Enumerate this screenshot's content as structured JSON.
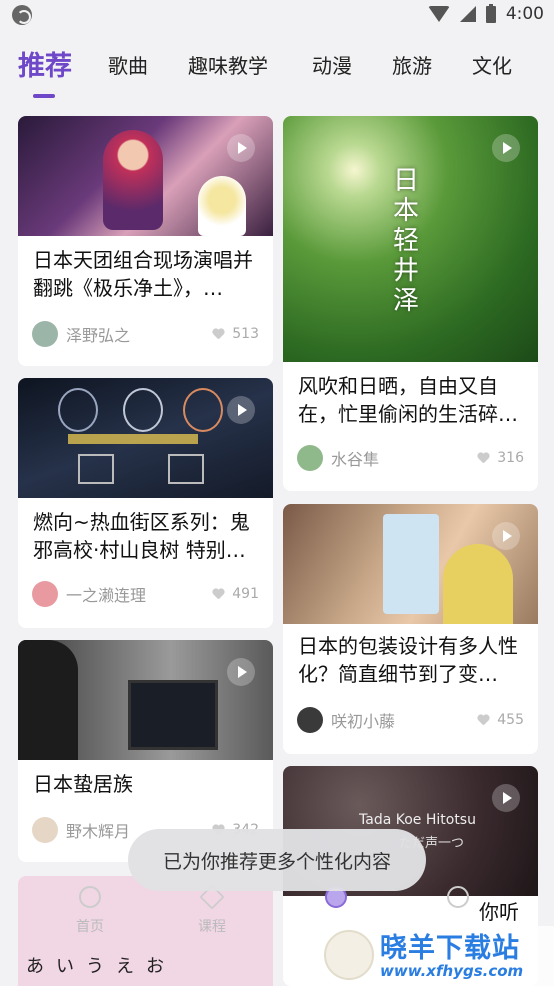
{
  "status_bar": {
    "time": "4:00"
  },
  "tabs": [
    {
      "label": "推荐",
      "active": true
    },
    {
      "label": "歌曲"
    },
    {
      "label": "趣味教学"
    },
    {
      "label": "动漫"
    },
    {
      "label": "旅游"
    },
    {
      "label": "文化"
    }
  ],
  "cards": [
    {
      "title": "日本天团组合现场演唱并翻跳《极乐净土》，…",
      "author": "泽野弘之",
      "likes": "513",
      "thumb_color": "#4a2a5e",
      "avatar_color": "#9bb5a8"
    },
    {
      "title": "风吹和日晒，自由又自在，忙里偷闲的生活碎…",
      "author": "水谷隼",
      "likes": "316",
      "thumb_color": "#3d7a2e",
      "avatar_color": "#8fb98a",
      "overlay_text": "日本轻井泽"
    },
    {
      "title": "燃向~热血街区系列：鬼邪高校·村山良树 特别…",
      "author": "一之濑连理",
      "likes": "491",
      "thumb_color": "#1e2436",
      "avatar_color": "#e89aa0"
    },
    {
      "title": "日本的包装设计有多人性化？简直细节到了变…",
      "author": "咲初小藤",
      "likes": "455",
      "thumb_color": "#b08060",
      "avatar_color": "#3a3a3a"
    },
    {
      "title": "日本蛰居族",
      "author": "野木辉月",
      "likes": "342",
      "thumb_color": "#2c2c2c",
      "avatar_color": "#e6d6c6"
    },
    {
      "title": "",
      "author": "",
      "likes": "",
      "thumb_color": "#3a2a2a",
      "avatar_color": "#ccc",
      "overlay_text": "Tada Koe Hitotsu",
      "overlay_sub": "ただ声一つ"
    },
    {
      "title": "",
      "thumb_color": "#f1d6e4",
      "overlay_text": "あいうえお"
    }
  ],
  "peek_text": "你听",
  "toast": {
    "message": "已为你推荐更多个性化内容"
  },
  "bottom_nav": [
    {
      "label": "首页"
    },
    {
      "label": "课程"
    },
    {
      "label": ""
    },
    {
      "label": ""
    }
  ],
  "watermark": {
    "title": "晓羊下载站",
    "url": "www.xfhygs.com"
  },
  "colors": {
    "accent": "#6f48c9",
    "background": "#f2f2f4"
  }
}
